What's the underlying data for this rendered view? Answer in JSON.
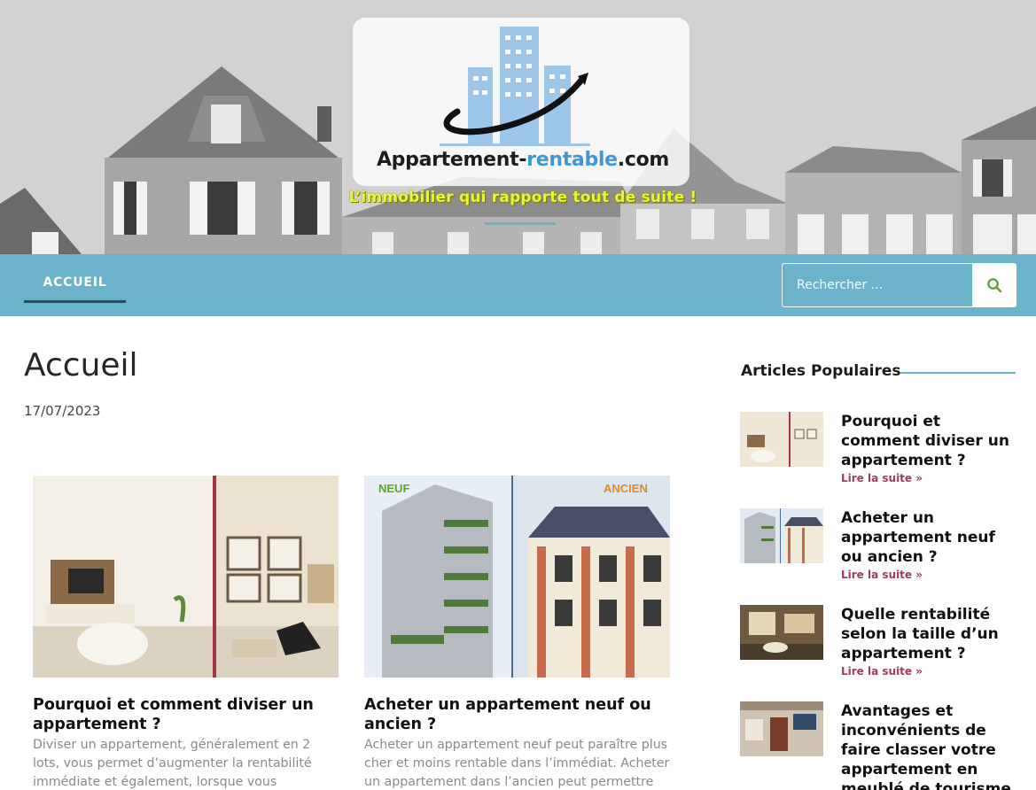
{
  "header": {
    "logo_text_pre": "Appartement-",
    "logo_text_accent": "rentable",
    "logo_text_post": ".com",
    "tagline": "L’immobilier qui rapporte tout de suite !"
  },
  "nav": {
    "items": [
      {
        "label": "ACCUEIL",
        "active": true
      }
    ],
    "search_placeholder": "Rechercher ...",
    "search_icon": "search-icon"
  },
  "page": {
    "title": "Accueil",
    "date": "17/07/2023"
  },
  "cards": [
    {
      "image_labels": [],
      "title": "Pourquoi et comment diviser un appartement ?",
      "excerpt": "Diviser un appartement, généralement en 2 lots, vous permet d’augmenter la rentabilité immédiate et également, lorsque vous déciderez"
    },
    {
      "image_labels": [
        "NEUF",
        "ANCIEN"
      ],
      "title": "Acheter un appartement neuf ou ancien ?",
      "excerpt": "Acheter un appartement neuf peut paraître plus cher et moins rentable dans l’immédiat. Acheter un appartement dans l’ancien peut permettre"
    }
  ],
  "sidebar": {
    "heading": "Articles Populaires",
    "items": [
      {
        "title": "Pourquoi et comment diviser un appartement ?",
        "more": "Lire la suite »"
      },
      {
        "title": "Acheter un appartement neuf ou ancien ?",
        "more": "Lire la suite »"
      },
      {
        "title": "Quelle rentabilité selon la taille d’un appartement ?",
        "more": "Lire la suite »"
      },
      {
        "title": "Avantages et inconvénients de faire classer votre appartement en meublé de tourisme",
        "more": ""
      }
    ]
  },
  "colors": {
    "nav_bg": "#6bb3cb",
    "tagline": "#e8f53a",
    "read_more": "#a03b5a",
    "logo_accent": "#3f97d6"
  }
}
